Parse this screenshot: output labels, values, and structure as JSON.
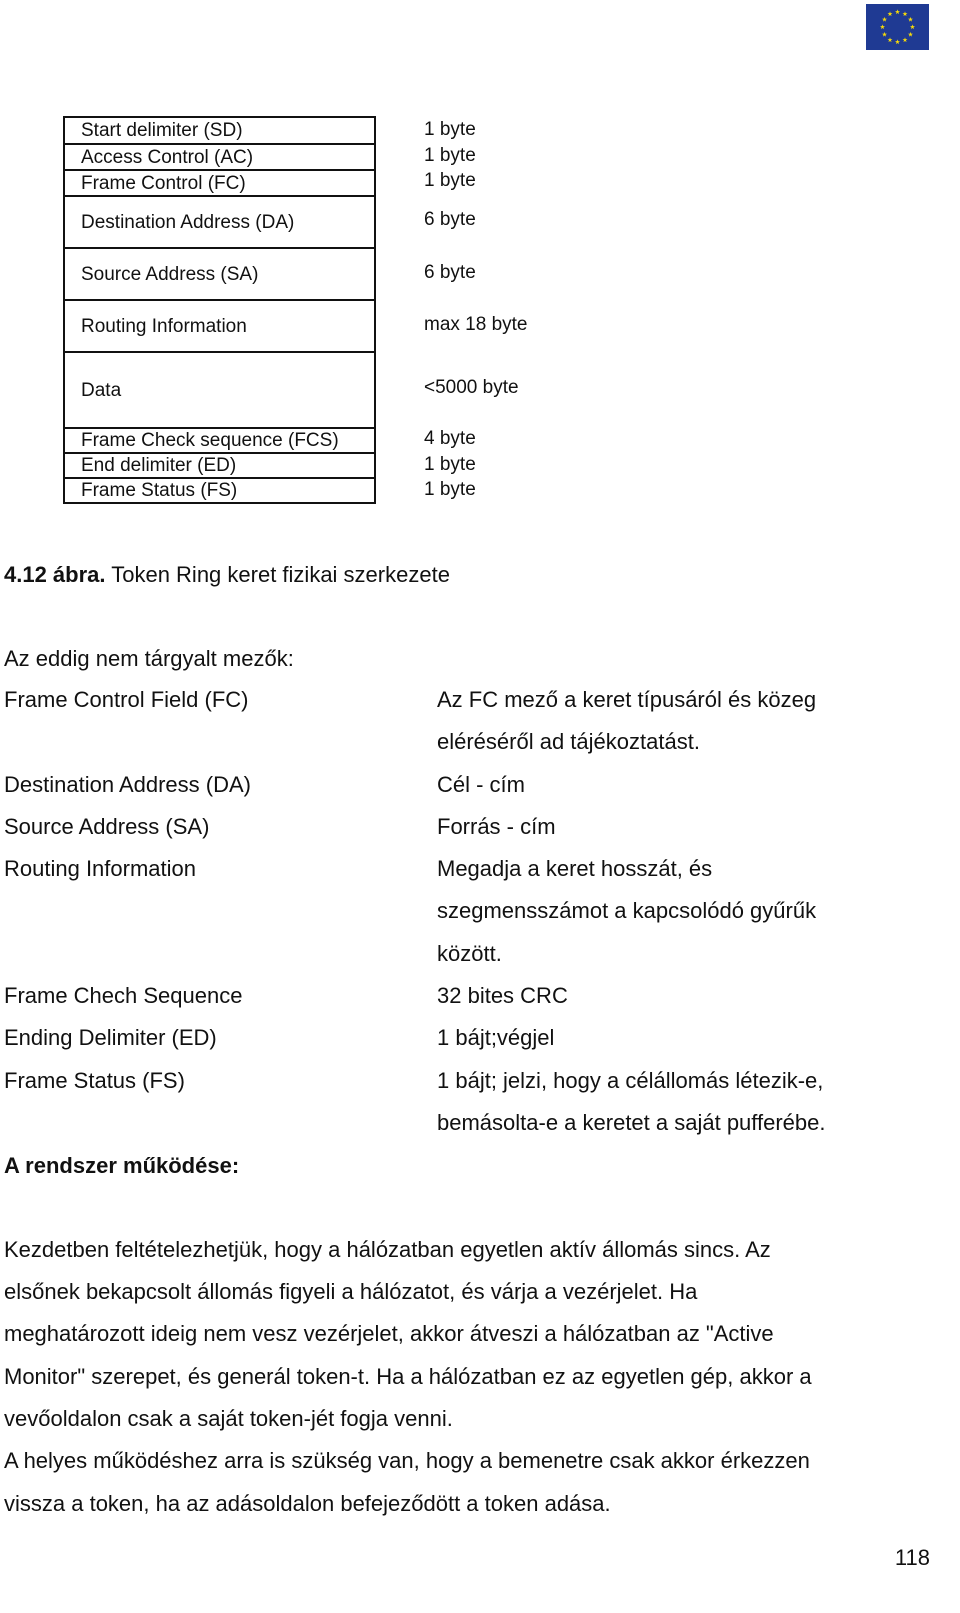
{
  "header": {
    "logo_icon": "eu-flag-icon",
    "logo_colors": {
      "background": "#1f3a93",
      "stars": "#f5d90a"
    }
  },
  "frame_structure": {
    "rows": [
      {
        "field": "Start delimiter (SD)",
        "size": "1 byte"
      },
      {
        "field": "Access Control (AC)",
        "size": "1 byte"
      },
      {
        "field": "Frame Control (FC)",
        "size": "1 byte"
      },
      {
        "field": "Destination Address (DA)",
        "size": "6 byte"
      },
      {
        "field": "Source Address (SA)",
        "size": "6 byte"
      },
      {
        "field": "Routing Information",
        "size": "max 18 byte"
      },
      {
        "field": "Data",
        "size": "<5000 byte"
      },
      {
        "field": "Frame Check sequence (FCS)",
        "size": "4 byte"
      },
      {
        "field": "End delimiter (ED)",
        "size": "1 byte"
      },
      {
        "field": "Frame Status (FS)",
        "size": "1 byte"
      }
    ]
  },
  "caption": {
    "label": "4.12 ábra.",
    "text": " Token Ring keret fizikai szerkezete"
  },
  "intro": "Az eddig nem tárgyalt mezők:",
  "definitions": [
    {
      "term": "Frame Control Field (FC)",
      "lines": [
        "Az FC mező a keret típusáról és közeg",
        "eléréséről ad tájékoztatást."
      ]
    },
    {
      "term": "Destination Address (DA)",
      "lines": [
        "Cél - cím"
      ]
    },
    {
      "term": "Source Address (SA)",
      "lines": [
        "Forrás - cím"
      ]
    },
    {
      "term": "Routing Information",
      "lines": [
        "Megadja a keret hosszát, és",
        "szegmensszámot a kapcsolódó gyűrűk",
        "között."
      ]
    },
    {
      "term": "Frame Chech Sequence",
      "lines": [
        "32 bites CRC"
      ]
    },
    {
      "term": "Ending Delimiter (ED)",
      "lines": [
        "1 bájt;végjel"
      ]
    },
    {
      "term": "Frame Status (FS)",
      "lines": [
        "1 bájt; jelzi, hogy a célállomás létezik-e,",
        "bemásolta-e a keretet a saját pufferébe."
      ]
    }
  ],
  "section_heading": "A rendszer működése:",
  "body_lines": [
    "Kezdetben feltételezhetjük, hogy a hálózatban egyetlen aktív állomás sincs. Az",
    "elsőnek bekapcsolt állomás figyeli a hálózatot, és várja a vezérjelet. Ha",
    "meghatározott ideig nem vesz vezérjelet, akkor átveszi a hálózatban az \"Active",
    "Monitor\" szerepet, és generál token-t. Ha a hálózatban ez az egyetlen gép, akkor a",
    "vevőoldalon csak a saját token-jét fogja venni.",
    "A helyes működéshez arra is szükség van, hogy a bemenetre csak akkor érkezzen",
    "vissza a token, ha az adásoldalon befejeződött a token adása."
  ],
  "page_number": "118"
}
